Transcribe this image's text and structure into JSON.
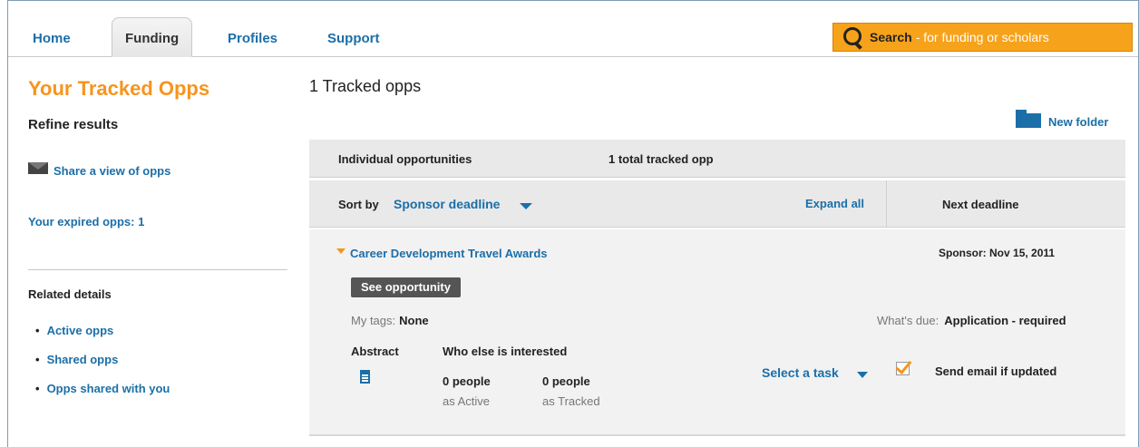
{
  "nav": {
    "tabs": [
      {
        "label": "Home"
      },
      {
        "label": "Funding",
        "active": true
      },
      {
        "label": "Profiles"
      },
      {
        "label": "Support"
      }
    ],
    "search": {
      "label": "Search",
      "hint": " - for funding or scholars"
    }
  },
  "sidebar": {
    "title": "Your Tracked Opps",
    "refine_label": "Refine results",
    "share_label": "Share a view of opps",
    "expired_label": "Your expired opps: 1",
    "related_title": "Related details",
    "related_items": [
      {
        "label": "Active opps"
      },
      {
        "label": "Shared opps"
      },
      {
        "label": "Opps shared with you"
      }
    ]
  },
  "main": {
    "count_title": "1 Tracked opps",
    "new_folder_label": "New folder",
    "summary": {
      "label": "Individual opportunities",
      "total": "1 total tracked opp"
    },
    "sort": {
      "label": "Sort by",
      "value": "Sponsor deadline",
      "expand_all": "Expand all",
      "next_deadline": "Next deadline"
    },
    "opportunity": {
      "title": "Career Development Travel Awards",
      "sponsor_label": "Sponsor:",
      "sponsor_date": "Nov 15, 2011",
      "see_button": "See opportunity",
      "tags_label": "My tags:",
      "tags_value": "None",
      "due_label": "What's due:",
      "due_value": "Application - required",
      "abstract_label": "Abstract",
      "interested_label": "Who else is interested",
      "active_count": "0 people",
      "active_label": "as Active",
      "tracked_count": "0 people",
      "tracked_label": "as Tracked",
      "task_label": "Select a task",
      "email_label": "Send email if updated",
      "email_checked": true
    }
  },
  "colors": {
    "accent": "#f7941d",
    "link": "#1b6fa8",
    "search_bg": "#f7a21b"
  }
}
